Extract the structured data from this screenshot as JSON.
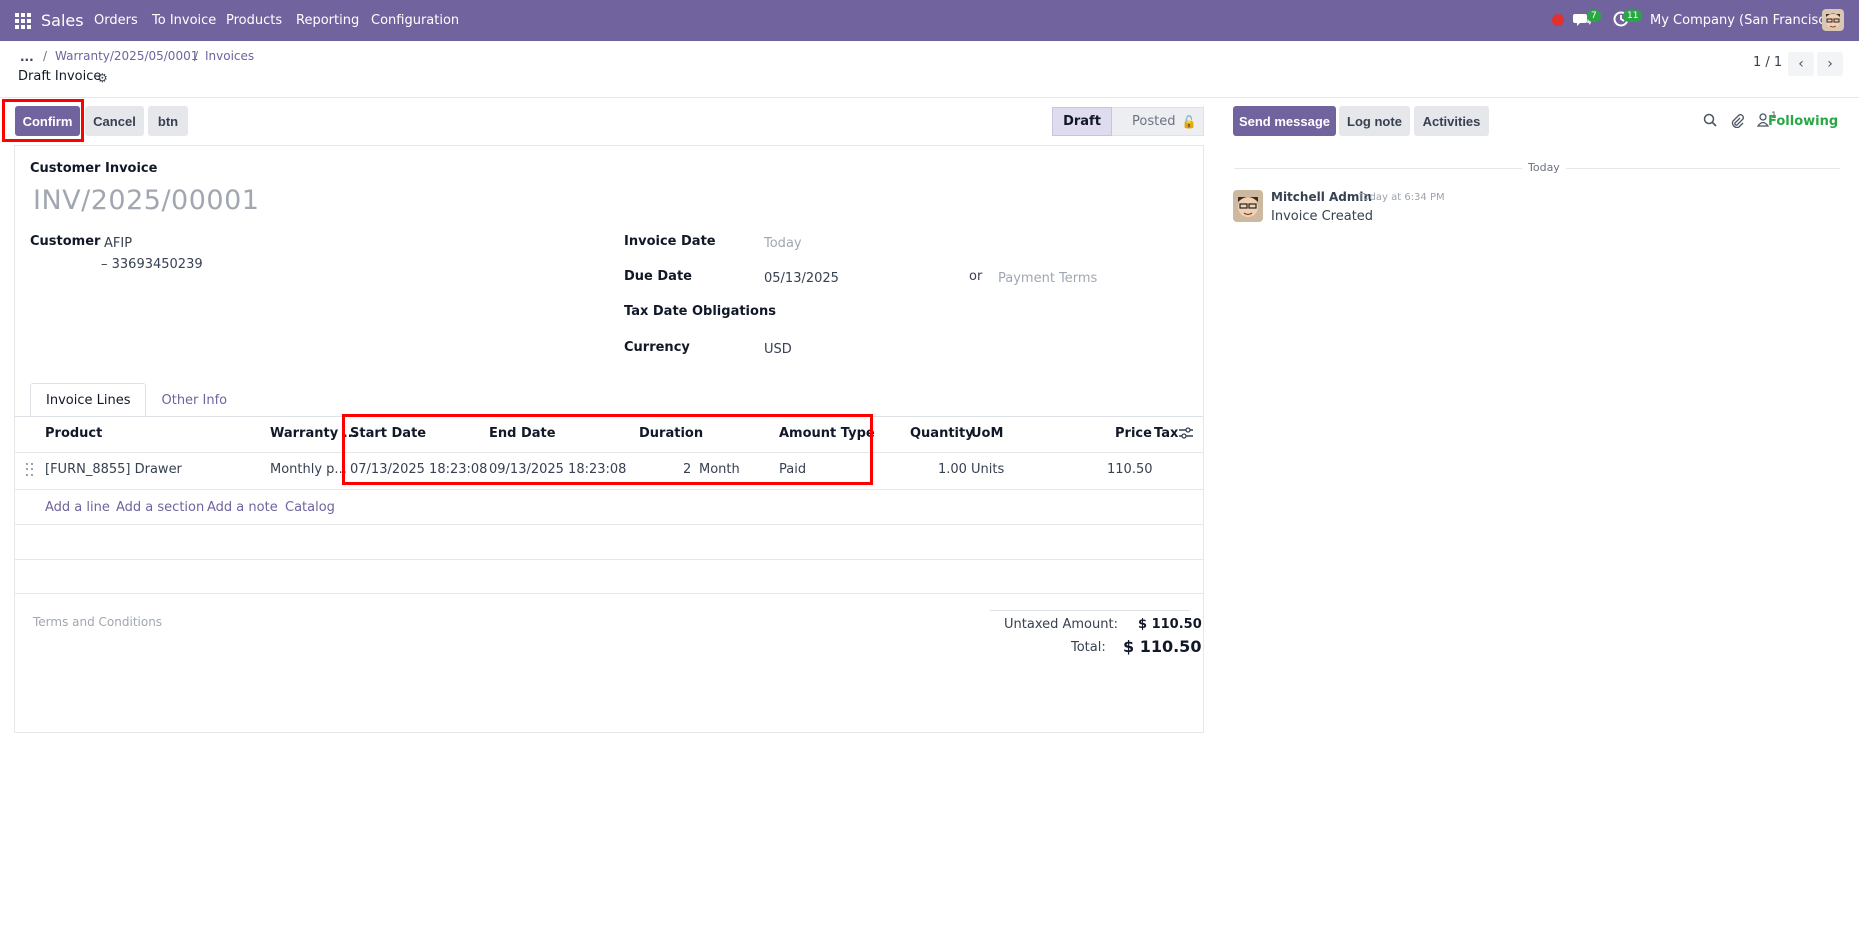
{
  "navbar": {
    "app_name": "Sales",
    "menu": [
      "Orders",
      "To Invoice",
      "Products",
      "Reporting",
      "Configuration"
    ],
    "messages_count": "7",
    "activities_count": "11",
    "company": "My Company (San Francisco)"
  },
  "breadcrumb": {
    "dots": "...",
    "sep": "/",
    "item1": "Warranty/2025/05/0001",
    "item2": "Invoices",
    "title": "Draft Invoice"
  },
  "pager": {
    "text": "1 / 1",
    "prev": "‹",
    "next": "›"
  },
  "actions": {
    "confirm": "Confirm",
    "cancel": "Cancel",
    "btn": "btn"
  },
  "status": {
    "draft": "Draft",
    "posted": "Posted"
  },
  "form": {
    "doc_type": "Customer Invoice",
    "number": "INV/2025/00001",
    "customer_label": "Customer",
    "customer_name": "AFIP",
    "customer_vat": "– 33693450239",
    "invoice_date_label": "Invoice Date",
    "invoice_date_placeholder": "Today",
    "due_date_label": "Due Date",
    "due_date": "05/13/2025",
    "or": "or",
    "payment_terms_placeholder": "Payment Terms",
    "tax_date_label": "Tax Date Obligations",
    "currency_label": "Currency",
    "currency": "USD"
  },
  "tabs": [
    "Invoice Lines",
    "Other Info"
  ],
  "table": {
    "headers": {
      "product": "Product",
      "warranty": "Warranty ...",
      "start": "Start Date",
      "end": "End Date",
      "duration": "Duration",
      "amount_type": "Amount Type",
      "quantity": "Quantity",
      "uom": "UoM",
      "price": "Price",
      "tax": "Tax"
    },
    "row": {
      "product": "[FURN_8855] Drawer",
      "warranty": "Monthly p...",
      "start": "07/13/2025 18:23:08",
      "end": "09/13/2025 18:23:08",
      "duration_value": "2",
      "duration_unit": "Month",
      "amount_type": "Paid",
      "quantity": "1.00",
      "uom": "Units",
      "price": "110.50"
    },
    "add_links": [
      "Add a line",
      "Add a section",
      "Add a note",
      "Catalog"
    ]
  },
  "terms_placeholder": "Terms and Conditions",
  "totals": {
    "untaxed_label": "Untaxed Amount:",
    "untaxed": "$ 110.50",
    "total_label": "Total:",
    "total": "$ 110.50"
  },
  "chatter": {
    "send_message": "Send message",
    "log_note": "Log note",
    "activities": "Activities",
    "followers_count": "1",
    "following": "Following",
    "day": "Today",
    "author": "Mitchell Admin",
    "date": "Today at 6:34 PM",
    "body": "Invoice Created"
  },
  "colors": {
    "brand": "#71639e",
    "highlight_box": "#ff0000",
    "success": "#28a745"
  }
}
